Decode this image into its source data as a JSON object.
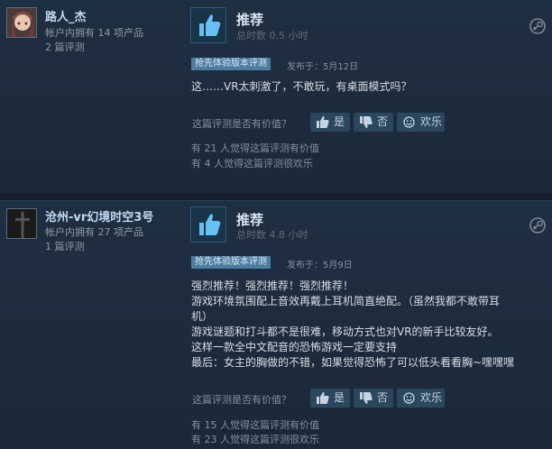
{
  "reviews": [
    {
      "user_name": "路人_杰",
      "products_owned": "帐户内拥有 14 项产品",
      "review_count": "2 篇评测",
      "verdict": "推荐",
      "hours": "总时数 0.5 小时",
      "badge": "抢先体验版本评测",
      "posted": "发布于：5月12日",
      "text": [
        "这……VR太刺激了，不敢玩，有桌面模式吗？"
      ],
      "helpful_question": "这篇评测是否有价值？",
      "buttons": {
        "yes": "是",
        "no": "否",
        "funny": "欢乐"
      },
      "helpful_stat": "有 21 人觉得这篇评测有价值",
      "funny_stat": "有 4 人觉得这篇评测很欢乐"
    },
    {
      "user_name": "沧州-vr幻境时空3号",
      "products_owned": "帐户内拥有 27 项产品",
      "review_count": "1 篇评测",
      "verdict": "推荐",
      "hours": "总时数 4.8 小时",
      "badge": "抢先体验版本评测",
      "posted": "发布于：5月9日",
      "text": [
        "强烈推荐！强烈推荐！强烈推荐！",
        "游戏环境氛围配上音效再戴上耳机简直绝配。（虽然我都不敢带耳",
        "机）",
        "游戏谜题和打斗都不是很难，移动方式也对VR的新手比较友好。",
        "这样一款全中文配音的恐怖游戏一定要支持",
        "最后：女主的胸做的不错，如果觉得恐怖了可以低头看看胸~嘿嘿嘿"
      ],
      "helpful_question": "这篇评测是否有价值？",
      "buttons": {
        "yes": "是",
        "no": "否",
        "funny": "欢乐"
      },
      "helpful_stat": "有 15 人觉得这篇评测有价值",
      "funny_stat": "有 23 人觉得这篇评测很欢乐"
    }
  ],
  "icons": {
    "thumb": "thumbs-up-icon",
    "steam": "steam-icon",
    "vote_yes": "thumbs-up-icon",
    "vote_no": "thumbs-down-icon",
    "vote_funny": "smiley-icon"
  },
  "colors": {
    "background": "#1b2838",
    "accent": "#67c1f5",
    "badge": "#4b7ca2",
    "thumb": "#66c0f4"
  }
}
